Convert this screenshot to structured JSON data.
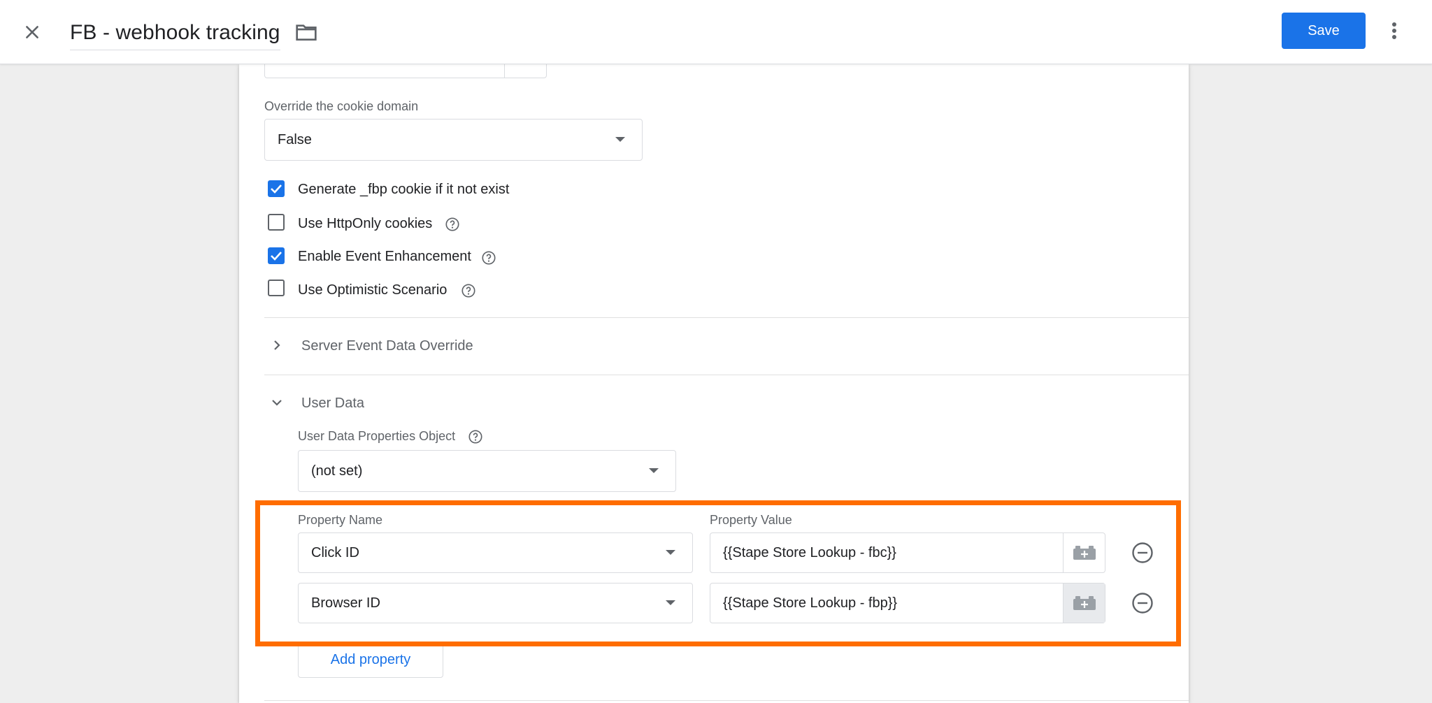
{
  "header": {
    "title": "FB - webhook tracking",
    "save_label": "Save"
  },
  "cookie_domain": {
    "label": "Override the cookie domain",
    "value": "False"
  },
  "checkboxes": [
    {
      "label": "Generate _fbp cookie if it not exist",
      "checked": true
    },
    {
      "label": "Use HttpOnly cookies",
      "checked": false
    },
    {
      "label": "Enable Event Enhancement",
      "checked": true
    },
    {
      "label": "Use Optimistic Scenario",
      "checked": false
    }
  ],
  "sections": {
    "server_event": "Server Event Data Override",
    "user_data": "User Data"
  },
  "user_data": {
    "props_object_label": "User Data Properties Object",
    "props_object_value": "(not set)",
    "col_name": "Property Name",
    "col_value": "Property Value",
    "rows": [
      {
        "name": "Click ID",
        "value": "{{Stape Store Lookup - fbc}}"
      },
      {
        "name": "Browser ID",
        "value": "{{Stape Store Lookup - fbp}}"
      }
    ],
    "add_label": "Add property"
  },
  "colors": {
    "accent": "#1a73e8",
    "highlight": "#ff6d00"
  }
}
